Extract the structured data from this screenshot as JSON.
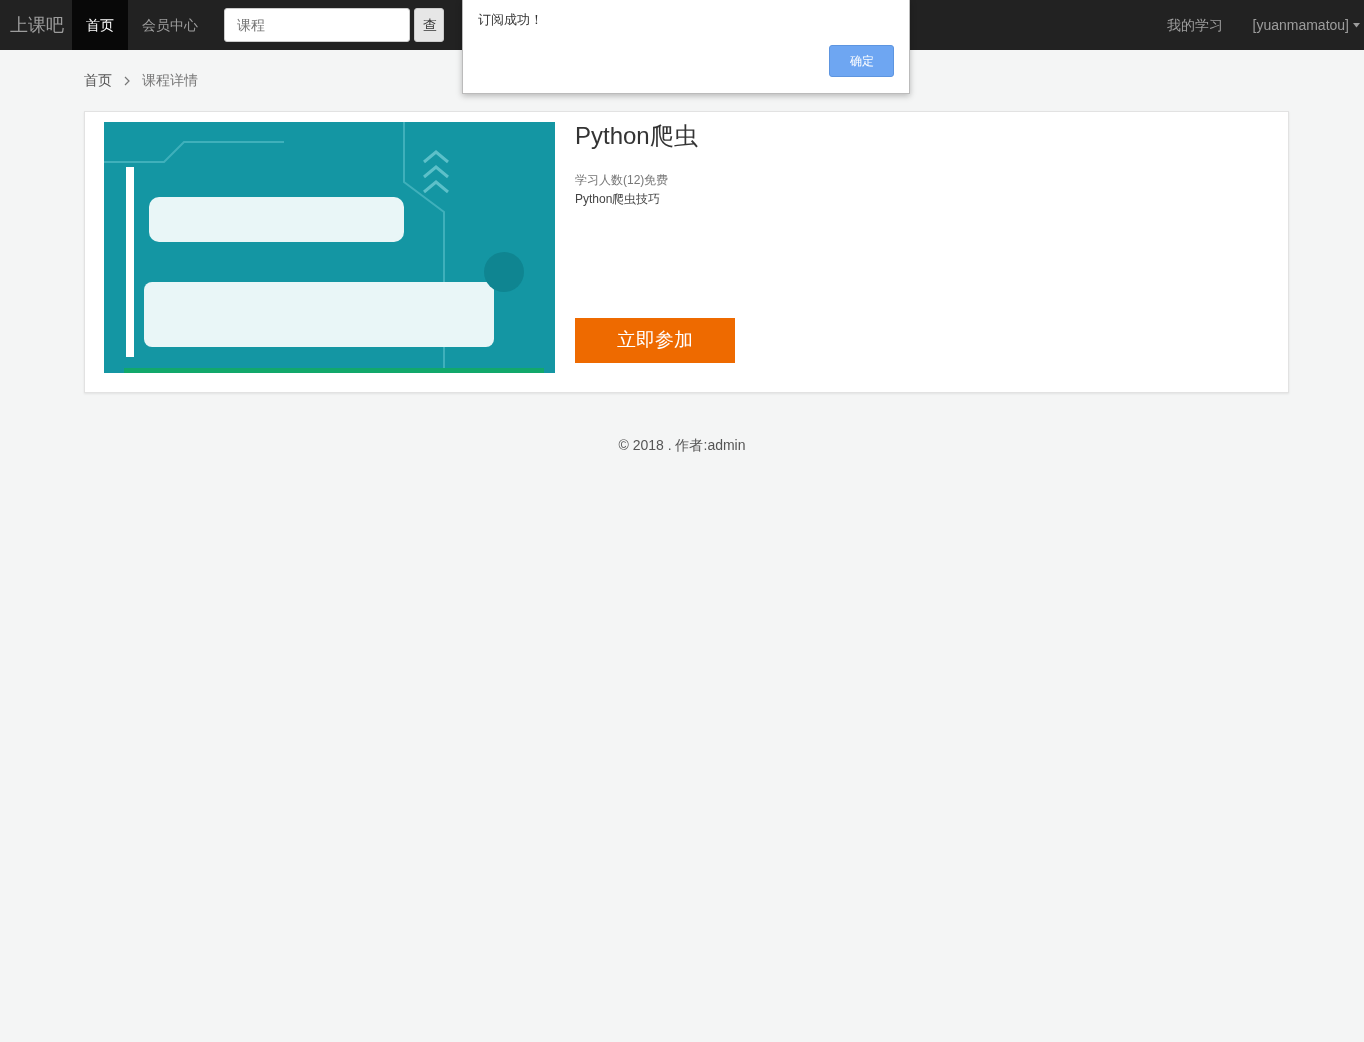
{
  "navbar": {
    "brand": "上课吧",
    "nav_items": [
      {
        "label": "首页",
        "selected": true
      },
      {
        "label": "会员中心",
        "selected": false
      }
    ],
    "search": {
      "placeholder": "课程",
      "button": "查"
    },
    "right_items": [
      {
        "label": "我的学习",
        "kind": "link"
      },
      {
        "label": "[yuanmamatou]",
        "kind": "dropdown"
      }
    ]
  },
  "breadcrumb": [
    "首页",
    "课程详情"
  ],
  "course": {
    "title": "Python爬虫",
    "meta": "学习人数(12)免费",
    "description": "Python爬虫技巧",
    "join_button": "立即参加"
  },
  "footer": "© 2018 . 作者:admin",
  "dialog": {
    "message": "订阅成功！",
    "ok_button": "确定"
  }
}
